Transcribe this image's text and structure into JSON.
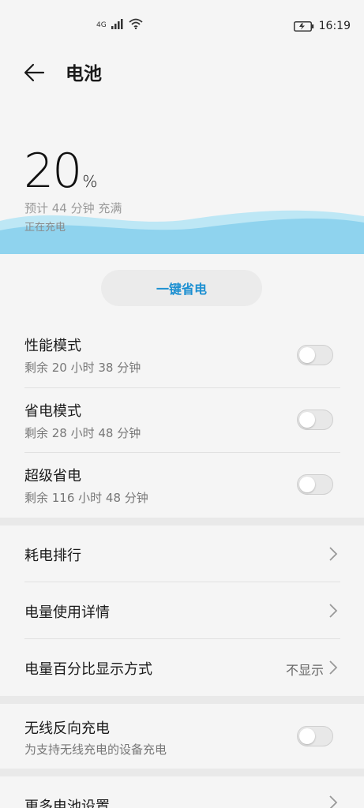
{
  "status_bar": {
    "network": "4G",
    "time": "16:19"
  },
  "header": {
    "title": "电池"
  },
  "battery": {
    "level_number": "20",
    "level_unit": "%",
    "estimate": "预计 44 分钟 充满",
    "state": "正在充电"
  },
  "quick_save": {
    "label": "一键省电"
  },
  "modes": [
    {
      "title": "性能模式",
      "subtitle": "剩余 20 小时 38 分钟",
      "enabled": false
    },
    {
      "title": "省电模式",
      "subtitle": "剩余 28 小时 48 分钟",
      "enabled": false
    },
    {
      "title": "超级省电",
      "subtitle": "剩余 116 小时 48 分钟",
      "enabled": false
    }
  ],
  "details": [
    {
      "title": "耗电排行"
    },
    {
      "title": "电量使用详情"
    },
    {
      "title": "电量百分比显示方式",
      "value": "不显示"
    }
  ],
  "wireless": {
    "title": "无线反向充电",
    "subtitle": "为支持无线充电的设备充电",
    "enabled": false
  },
  "more": {
    "title": "更多电池设置"
  },
  "colors": {
    "accent": "#1b8fd1",
    "wave_light": "#bde7f5",
    "wave_main": "#8fd3ee",
    "background": "#f5f5f5"
  }
}
